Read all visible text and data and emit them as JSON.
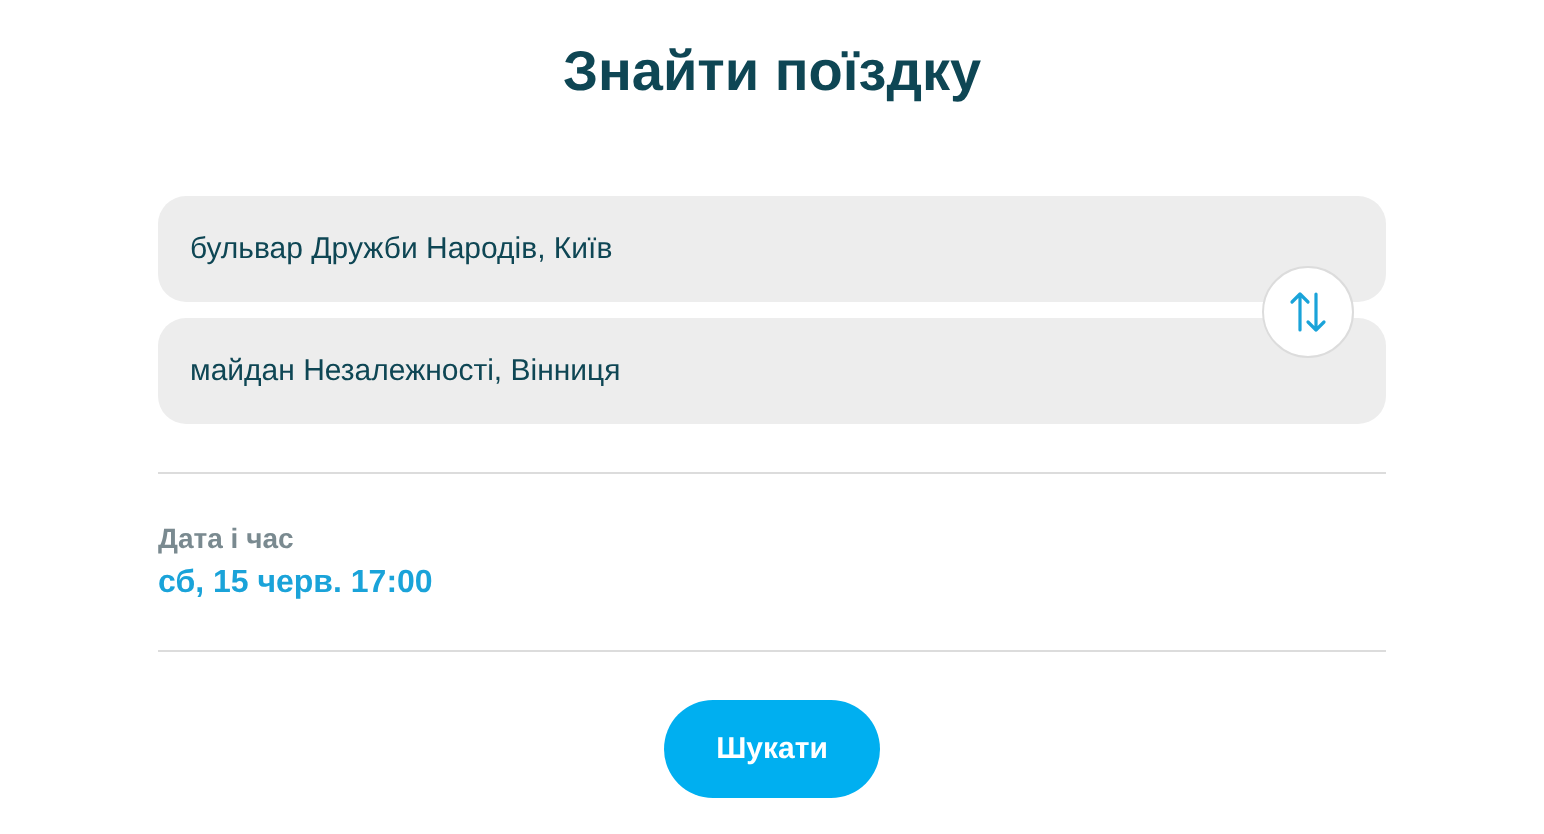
{
  "title": "Знайти поїздку",
  "route": {
    "from": {
      "value": "бульвар Дружби Народів, Київ"
    },
    "to": {
      "value": "майдан Незалежності, Вінниця"
    }
  },
  "date_time": {
    "label": "Дата і час",
    "value": "сб, 15 черв. 17:00"
  },
  "search_button": {
    "label": "Шукати"
  }
}
